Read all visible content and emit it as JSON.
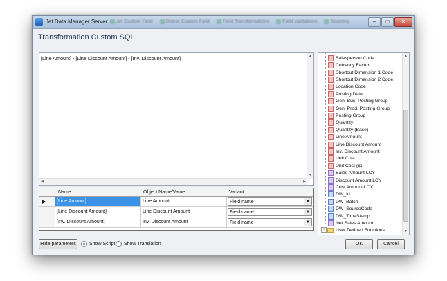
{
  "window": {
    "title": "Jet Data Manager Server",
    "background_tabs": [
      "Jet Custom Field",
      "Delete Custom Field",
      "Field Transformations",
      "Field validations",
      "Sourcing"
    ]
  },
  "dialog": {
    "title": "Transformation Custom SQL"
  },
  "script": {
    "text": "[Line Amount] - [Line Discount Amount] - [Inv. Discount Amount]"
  },
  "grid": {
    "columns": [
      "Name",
      "Object Name/Value",
      "Variant"
    ],
    "rows": [
      {
        "name": "[Line Amount]",
        "value": "Line Amount",
        "variant": "Field name"
      },
      {
        "name": "[Line Discount Amount]",
        "value": "Line Discount Amount",
        "variant": "Field name"
      },
      {
        "name": "[Inv. Discount Amount]",
        "value": "Inv. Discount Amount",
        "variant": "Field name"
      }
    ]
  },
  "tree": {
    "items": [
      {
        "label": "Salesperson Code",
        "icon": "field-icon"
      },
      {
        "label": "Currency Factor",
        "icon": "field-icon"
      },
      {
        "label": "Shortcut Dimension 1 Code",
        "icon": "field-icon"
      },
      {
        "label": "Shortcut Dimension 2 Code",
        "icon": "field-icon"
      },
      {
        "label": "Location Code",
        "icon": "field-icon"
      },
      {
        "label": "Posting Date",
        "icon": "field-icon"
      },
      {
        "label": "Gen. Bus. Posting Group",
        "icon": "field-icon"
      },
      {
        "label": "Gen. Prod. Posting Group",
        "icon": "field-icon"
      },
      {
        "label": "Posting Group",
        "icon": "field-icon"
      },
      {
        "label": "Quantity",
        "icon": "field-icon"
      },
      {
        "label": "Quantity (Base)",
        "icon": "field-icon"
      },
      {
        "label": "Line Amount",
        "icon": "field-icon"
      },
      {
        "label": "Line Discount Amount",
        "icon": "field-icon"
      },
      {
        "label": "Inv. Discount Amount",
        "icon": "field-icon"
      },
      {
        "label": "Unit Cost",
        "icon": "field-icon"
      },
      {
        "label": "Unit Cost ($)",
        "icon": "field-icon"
      },
      {
        "label": "Sales Amount LCY",
        "icon": "custom-field-icon"
      },
      {
        "label": "Discount Amount LCY",
        "icon": "custom-field-icon"
      },
      {
        "label": "Cost Amount LCY",
        "icon": "custom-field-icon"
      },
      {
        "label": "DW_Id",
        "icon": "system-field-icon"
      },
      {
        "label": "DW_Batch",
        "icon": "system-field-icon"
      },
      {
        "label": "DW_SourceCode",
        "icon": "system-field-icon"
      },
      {
        "label": "DW_TimeStamp",
        "icon": "system-field-icon"
      },
      {
        "label": "Net Sales Amount",
        "icon": "custom-field-icon"
      },
      {
        "label": "User Defined Functions",
        "icon": "folder-icon"
      }
    ]
  },
  "footer": {
    "hide_parameters": "Hide parameters",
    "show_script": "Show Script",
    "show_translation": "Show Translation",
    "show_script_checked": true,
    "ok": "OK",
    "cancel": "Cancel"
  }
}
